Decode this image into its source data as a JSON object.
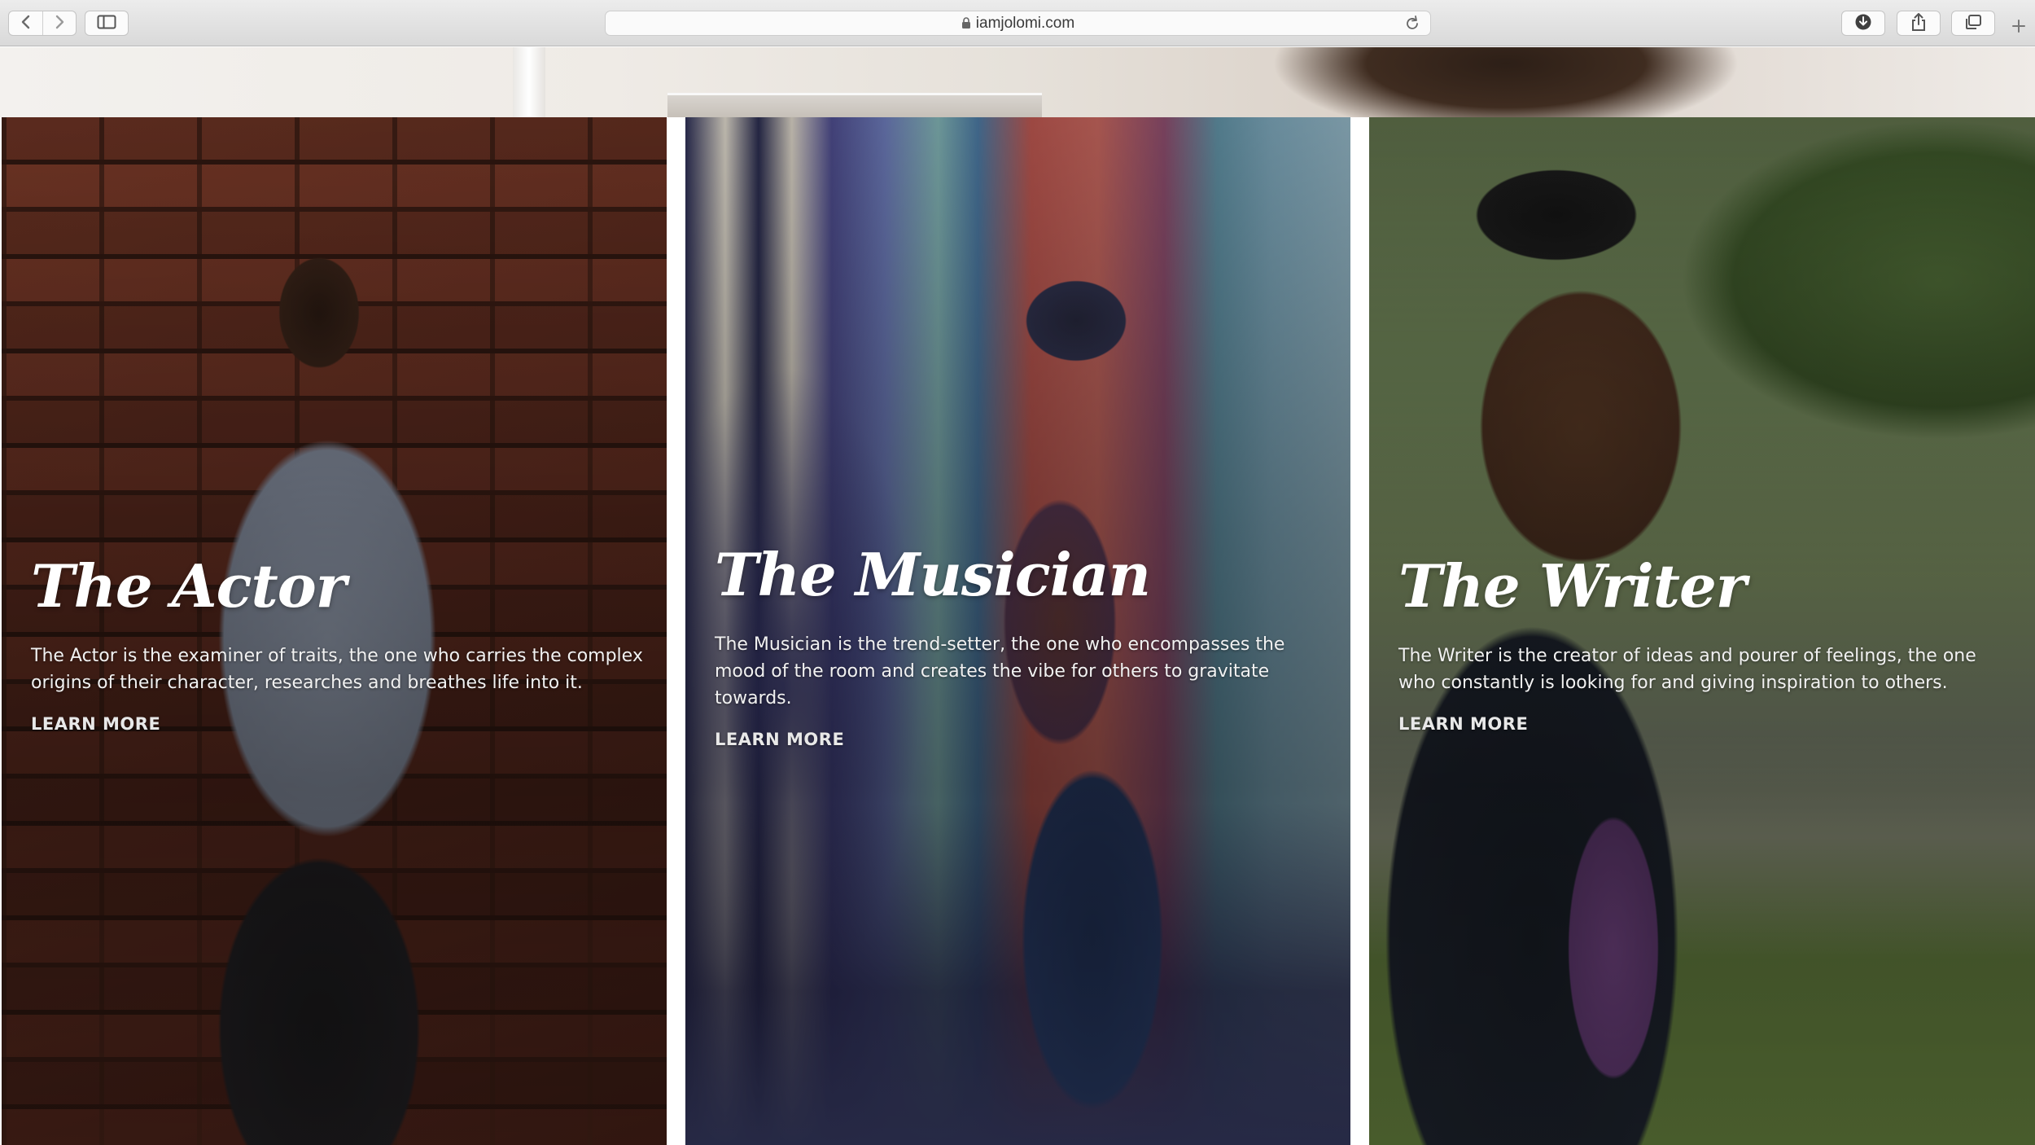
{
  "browser": {
    "url": "iamjolomi.com",
    "icons": {
      "back": "chevron-left-icon",
      "forward": "chevron-right-icon",
      "sidebar": "sidebar-icon",
      "lock": "lock-icon",
      "reload": "reload-icon",
      "download": "download-icon",
      "share": "share-icon",
      "tabs": "tabs-icon",
      "new_tab": "plus-icon"
    }
  },
  "panels": [
    {
      "title": "The Actor",
      "description": "The Actor is the examiner of traits, the one who carries the complex origins of their character, researches and breathes life into it.",
      "link": "LEARN MORE"
    },
    {
      "title": "The Musician",
      "description": "The Musician is the trend-setter, the one who encompasses the mood of the room and creates the vibe for others to gravitate towards.",
      "link": "LEARN MORE"
    },
    {
      "title": "The Writer",
      "description": "The Writer is the creator of ideas and pourer of feelings, the one who constantly is looking for and giving inspiration to others.",
      "link": "LEARN MORE"
    }
  ]
}
